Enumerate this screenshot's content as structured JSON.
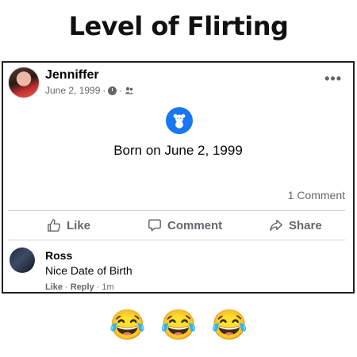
{
  "meme": {
    "title": "Level of Flirting"
  },
  "post": {
    "author": "Jenniffer",
    "date": "June 2, 1999",
    "meta_sep": "·",
    "event_text": "Born on June 2, 1999",
    "comment_count": "1 Comment",
    "more_icon": "more-options-icon",
    "event_icon": "teddy-bear-icon",
    "accent_color": "#1877f2",
    "actions": {
      "like": "Like",
      "comment": "Comment",
      "share": "Share"
    }
  },
  "comment": {
    "author": "Ross",
    "text": "Nice Date of Birth",
    "like": "Like",
    "reply": "Reply",
    "time": "1m",
    "sep": "·"
  },
  "reactions": [
    "😂",
    "😂",
    "😂"
  ]
}
